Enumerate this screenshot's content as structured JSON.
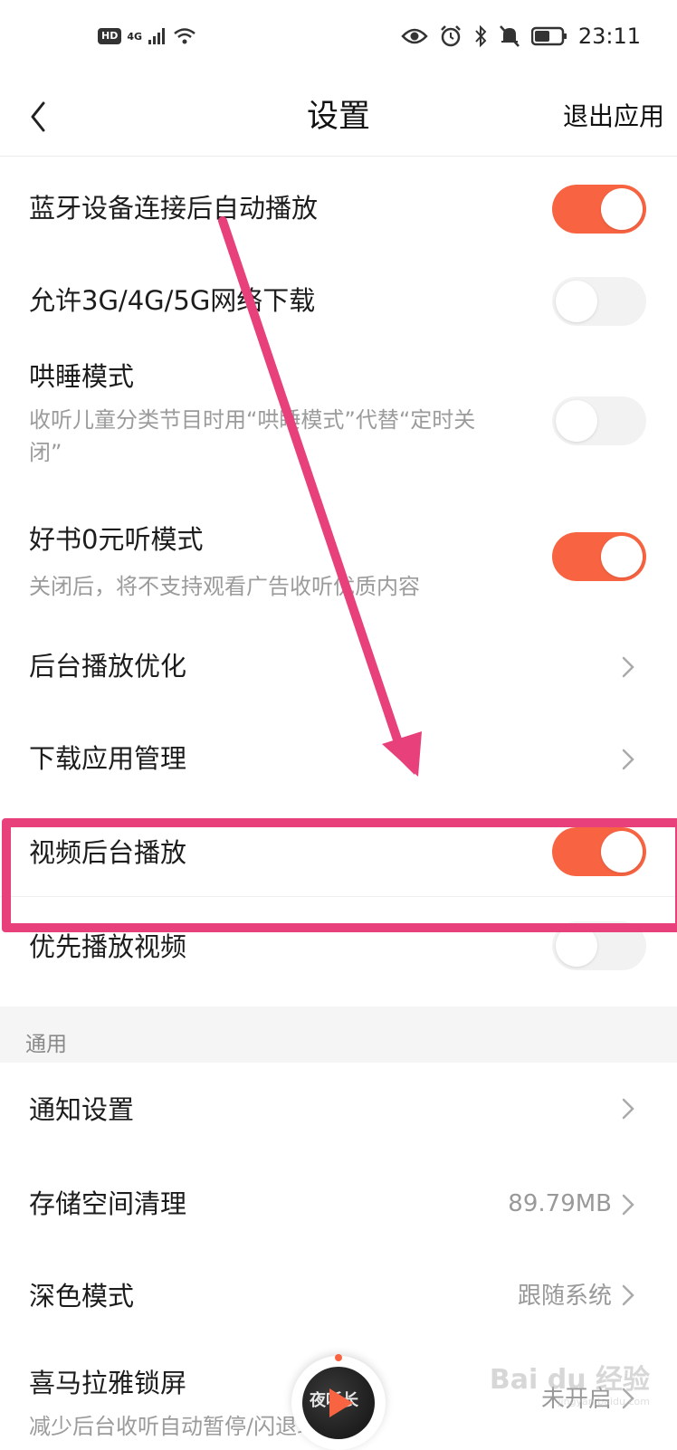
{
  "status_bar": {
    "hd_badge": "HD",
    "network": "4G",
    "time": "23:11"
  },
  "navbar": {
    "title": "设置",
    "exit_label": "退出应用"
  },
  "settings": [
    {
      "title": "蓝牙设备连接后自动播放",
      "toggle": true
    },
    {
      "title": "允许3G/4G/5G网络下载",
      "toggle": false
    },
    {
      "title": "哄睡模式",
      "subtitle": "收听儿童分类节目时用“哄睡模式”代替“定时关闭”",
      "toggle": false
    },
    {
      "title": "好书0元听模式",
      "subtitle": "关闭后，将不支持观看广告收听优质内容",
      "toggle": true
    },
    {
      "title": "后台播放优化"
    },
    {
      "title": "下载应用管理"
    },
    {
      "title": "视频后台播放",
      "toggle": true
    },
    {
      "title": "优先播放视频",
      "toggle": false
    }
  ],
  "general_section": {
    "header": "通用",
    "items": [
      {
        "title": "通知设置"
      },
      {
        "title": "存储空间清理",
        "value": "89.79MB"
      },
      {
        "title": "深色模式",
        "value": "跟随系统"
      },
      {
        "title": "喜马拉雅锁屏",
        "subtitle": "减少后台收听自动暂停/闪退现象",
        "value": "未开启"
      }
    ]
  },
  "mini_player": {
    "cover_text": "夜听长"
  },
  "watermark": {
    "main": "Bai du 经验",
    "sub": "jingyan.baidu.com"
  },
  "colors": {
    "accent": "#f86442",
    "annotation": "#e7407a",
    "toggle_off": "#f2f2f2",
    "section_bg": "#f5f5f5"
  }
}
